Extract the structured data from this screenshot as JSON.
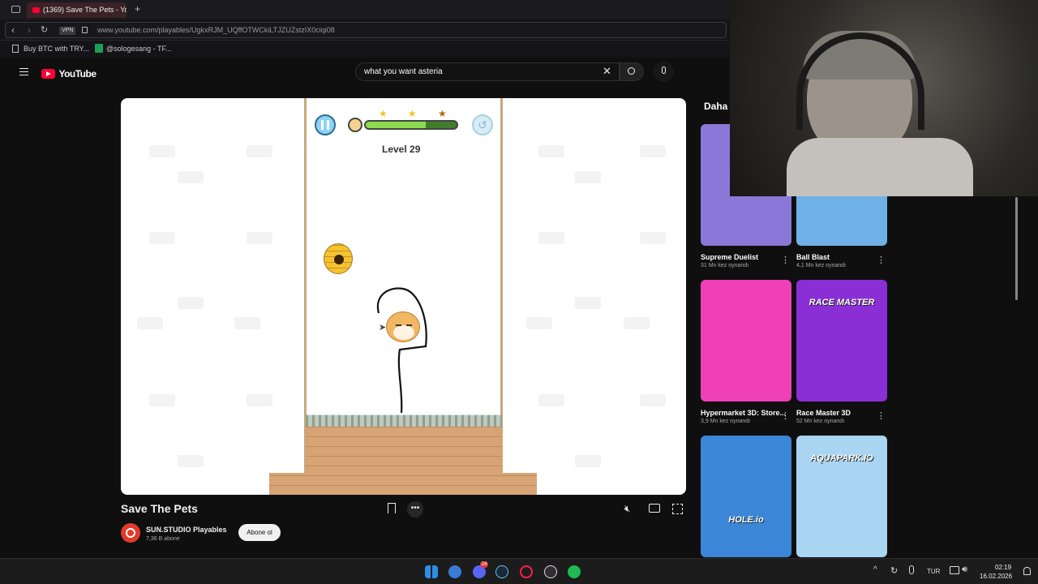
{
  "browser": {
    "tab_title": "(1369) Save The Pets - Yo",
    "vpn_label": "VPN",
    "url": "www.youtube.com/playables/UgkxRJM_UQffOTWCkiLTJZUZstzIX0ciqi08",
    "bookmarks": [
      "Buy BTC with TRY...",
      "@sologesang - TF..."
    ]
  },
  "youtube": {
    "logo_text": "YouTube",
    "search_value": "what you want asteria"
  },
  "game": {
    "level_label": "Level 29",
    "stars_earned": 3
  },
  "video": {
    "title": "Save The Pets",
    "channel": "SUN.STUDIO Playables",
    "subscribers": "7,36 B abone",
    "subscribe_label": "Abone ol"
  },
  "sidebar": {
    "title": "Daha",
    "cards": [
      {
        "title": "Supreme Duelist",
        "plays": "31 Mn kez oynandı",
        "color": "#8a78d8"
      },
      {
        "title": "Ball Blast",
        "plays": "4,1 Mn kez oynandı",
        "color": "#6fb0e6"
      },
      {
        "title": "Hypermarket 3D: Store...",
        "plays": "3,9 Mn kez oynandı",
        "color": "#ee3fb6"
      },
      {
        "title": "Race Master 3D",
        "plays": "52 Mn kez oynandı",
        "color": "#8a2fd6",
        "banner": "RACE MASTER"
      },
      {
        "title": "",
        "plays": "",
        "color": "#3b86d6",
        "banner": "HOLE.io"
      },
      {
        "title": "",
        "plays": "",
        "color": "#a9d4f2",
        "banner": "AQUAPARK.IO"
      }
    ]
  },
  "taskbar": {
    "lang": "TUR",
    "time": "02:19",
    "date": "16.02.2026",
    "discord_badge": "24"
  }
}
